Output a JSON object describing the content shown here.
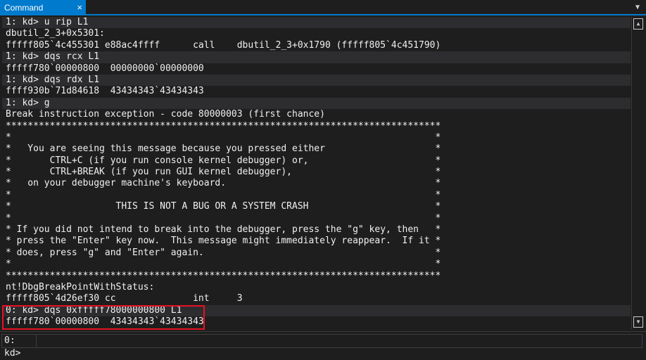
{
  "window": {
    "tab_label": "Command",
    "close_glyph": "×",
    "dropdown_glyph": "▼"
  },
  "output": {
    "lines": [
      {
        "text": "1: kd> u rip L1",
        "cmd": true
      },
      {
        "text": "dbutil_2_3+0x5301:",
        "cmd": false
      },
      {
        "text": "fffff805`4c455301 e88ac4ffff      call    dbutil_2_3+0x1790 (fffff805`4c451790)",
        "cmd": false
      },
      {
        "text": "1: kd> dqs rcx L1",
        "cmd": true
      },
      {
        "text": "fffff780`00000800  00000000`00000000",
        "cmd": false
      },
      {
        "text": "1: kd> dqs rdx L1",
        "cmd": true
      },
      {
        "text": "ffff930b`71d84618  43434343`43434343",
        "cmd": false
      },
      {
        "text": "1: kd> g",
        "cmd": true
      },
      {
        "text": "Break instruction exception - code 80000003 (first chance)",
        "cmd": false
      },
      {
        "text": "*******************************************************************************",
        "cmd": false
      },
      {
        "text": "*                                                                             *",
        "cmd": false
      },
      {
        "text": "*   You are seeing this message because you pressed either                    *",
        "cmd": false
      },
      {
        "text": "*       CTRL+C (if you run console kernel debugger) or,                       *",
        "cmd": false
      },
      {
        "text": "*       CTRL+BREAK (if you run GUI kernel debugger),                          *",
        "cmd": false
      },
      {
        "text": "*   on your debugger machine's keyboard.                                      *",
        "cmd": false
      },
      {
        "text": "*                                                                             *",
        "cmd": false
      },
      {
        "text": "*                   THIS IS NOT A BUG OR A SYSTEM CRASH                       *",
        "cmd": false
      },
      {
        "text": "*                                                                             *",
        "cmd": false
      },
      {
        "text": "* If you did not intend to break into the debugger, press the \"g\" key, then   *",
        "cmd": false
      },
      {
        "text": "* press the \"Enter\" key now.  This message might immediately reappear.  If it *",
        "cmd": false
      },
      {
        "text": "* does, press \"g\" and \"Enter\" again.                                          *",
        "cmd": false
      },
      {
        "text": "*                                                                             *",
        "cmd": false
      },
      {
        "text": "*******************************************************************************",
        "cmd": false
      },
      {
        "text": "nt!DbgBreakPointWithStatus:",
        "cmd": false
      },
      {
        "text": "fffff805`4d26ef30 cc              int     3",
        "cmd": false
      },
      {
        "text": "0: kd> dqs 0xfffff78000000800 L1",
        "cmd": true
      },
      {
        "text": "fffff780`00000800  43434343`43434343",
        "cmd": false
      }
    ]
  },
  "scrollbar": {
    "up_glyph": "▲",
    "down_glyph": "▼"
  },
  "command_bar": {
    "prompt": "0: kd>",
    "input_value": ""
  },
  "colors": {
    "background": "#1e1e1e",
    "accent": "#007acc",
    "command_row": "#2d2d30",
    "highlight_border": "#e81123",
    "text": "#f0f0f0"
  }
}
